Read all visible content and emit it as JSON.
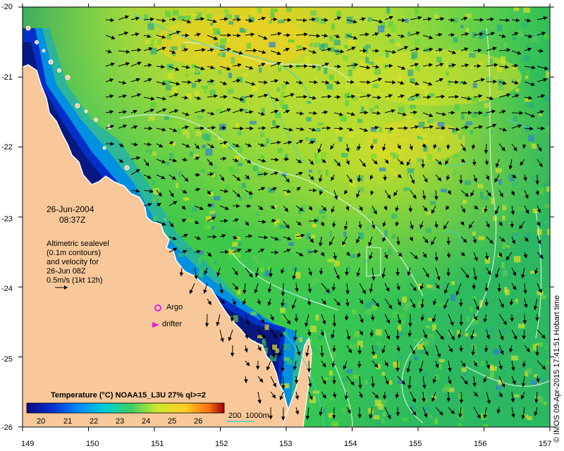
{
  "map": {
    "date": "26-Jun-2004",
    "time": "08:37Z",
    "legend_note": [
      "Altimetric sealevel",
      "(0.1m contours)",
      "and velocity for",
      "26-Jun 08Z",
      "0.5m/s (1kt 12h)"
    ],
    "markers": {
      "argo_label": "Argo",
      "drifter_label": "drifter",
      "argo_color": "#e020e0",
      "drifter_color": "#e020e0"
    },
    "colorbar": {
      "title": "Temperature (°C) NOAA15_L3U 27% ql>=2",
      "ticks": [
        "20",
        "21",
        "22",
        "23",
        "24",
        "25",
        "26"
      ],
      "min": 19.5,
      "max": 27,
      "stops": [
        "#0a0a80",
        "#0030d0",
        "#0090ff",
        "#00d0d0",
        "#40d060",
        "#c8e830",
        "#ffd020",
        "#ff7010",
        "#a00000"
      ]
    },
    "depth_legend": {
      "label_a": "200",
      "label_b": "1000m",
      "color": "#40d0d0"
    },
    "credit": "© IMOS 09-Apr-2015 17:41:51 Hobart time",
    "lon_ticks": [
      "149",
      "150",
      "151",
      "152",
      "153",
      "154",
      "155",
      "156",
      "157"
    ],
    "lat_ticks": [
      "-20",
      "-21",
      "-22",
      "-23",
      "-24",
      "-25",
      "-26"
    ],
    "colors": {
      "land": "#f8c89a",
      "coast": "#ffffff",
      "frame": "#000000"
    }
  }
}
